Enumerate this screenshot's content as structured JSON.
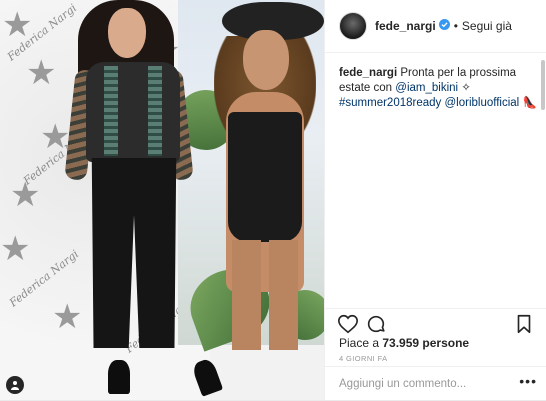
{
  "post": {
    "username": "fede_nargi",
    "verified": true,
    "follow_separator": "•",
    "follow_label": "Segui già",
    "caption": {
      "username": "fede_nargi",
      "text": "Pronta per la prossima estate con",
      "mention_1": "@iam_bikini",
      "sparkle": "✧",
      "hashtag": "#summer2018ready",
      "mention_2": "@loriblu​official",
      "heel": "👠"
    },
    "likes": {
      "prefix": "Piace a",
      "count": "73.959",
      "suffix": "persone"
    },
    "timestamp": "4 GIORNI FA",
    "comment": {
      "placeholder": "Aggiungi un commento...",
      "more": "•••"
    },
    "photo": {
      "brandmark": "Federica Nargi",
      "icons": [
        "user-tag-icon"
      ]
    }
  },
  "icons": {
    "like": "heart-outline-icon",
    "comment": "speech-bubble-icon",
    "save": "bookmark-icon",
    "verified": "verified-badge-icon"
  },
  "colors": {
    "verified_blue": "#3897f0",
    "link_blue": "#003569",
    "text": "#262626",
    "muted": "#999999"
  }
}
